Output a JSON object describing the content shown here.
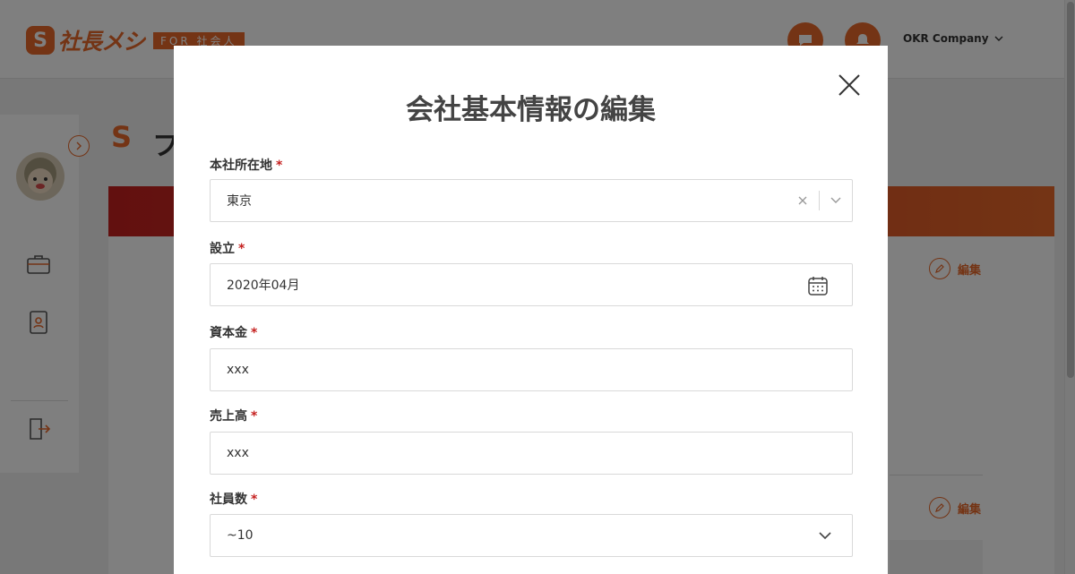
{
  "header": {
    "logo_mark": "S",
    "logo_text": "社長メシ",
    "logo_tag": "FOR 社会人",
    "company_name": "OKR Company",
    "icons": [
      "chat-icon",
      "notification-icon"
    ]
  },
  "page": {
    "title_mark": "S",
    "title_fragment": "フ",
    "edit_label_1": "編集",
    "edit_label_2": "編集"
  },
  "modal": {
    "title": "会社基本情報の編集",
    "required_mark": "*",
    "fields": {
      "location": {
        "label": "本社所在地",
        "value": "東京"
      },
      "founded": {
        "label": "設立",
        "value": "2020年04月"
      },
      "capital": {
        "label": "資本金",
        "value": "xxx"
      },
      "sales": {
        "label": "売上高",
        "value": "xxx"
      },
      "employees": {
        "label": "社員数",
        "value": "~10"
      }
    }
  },
  "colors": {
    "accent": "#e8692a",
    "brand_red": "#c5201f",
    "overlay": "rgba(0,0,0,0.5)"
  }
}
